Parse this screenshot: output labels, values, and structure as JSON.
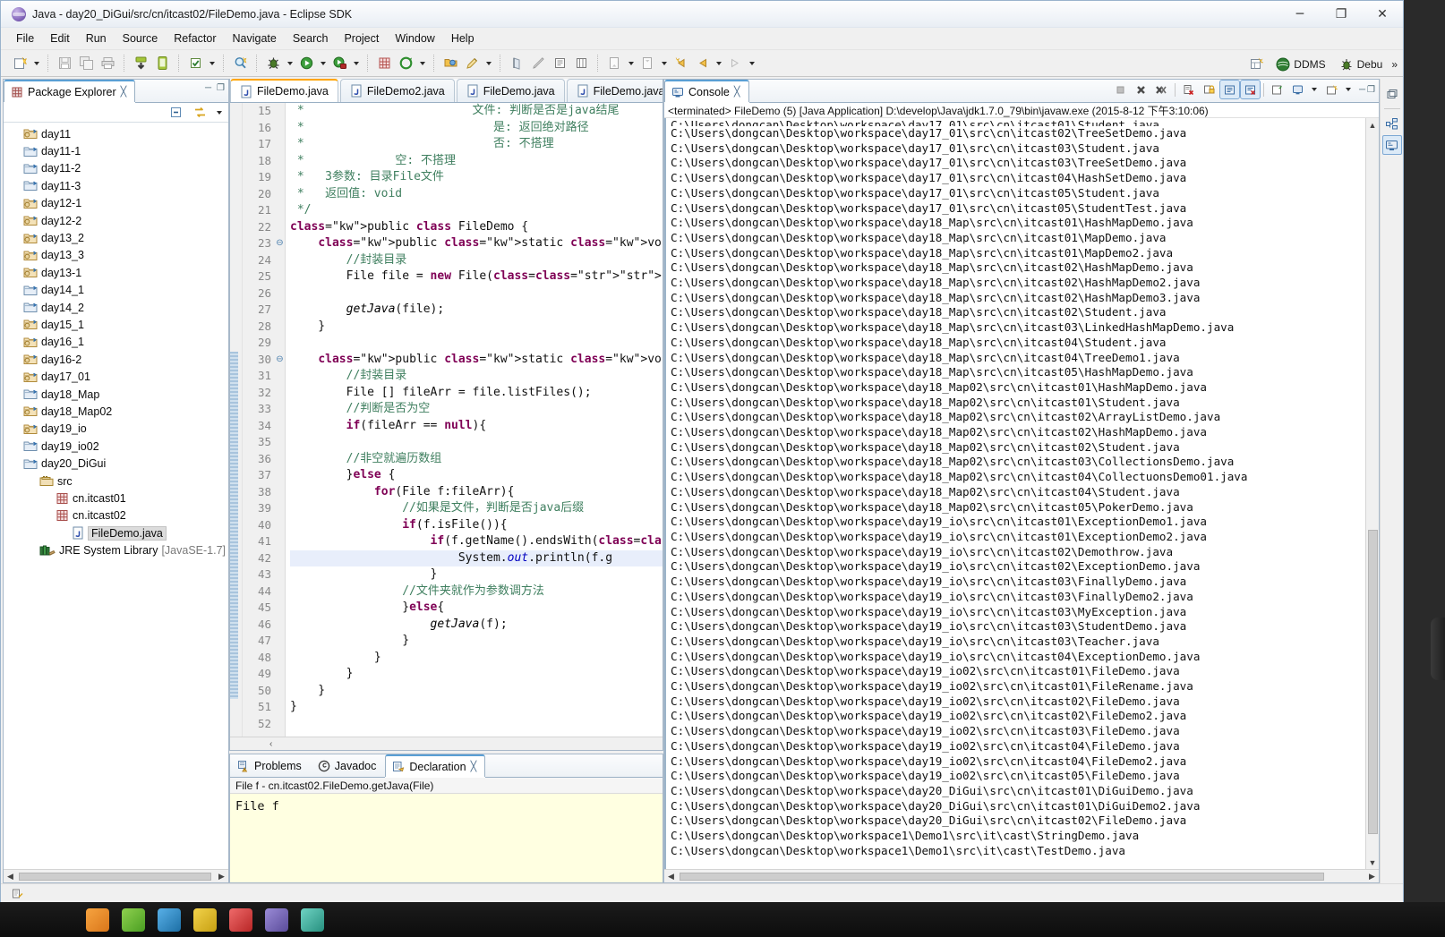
{
  "window": {
    "title": "Java - day20_DiGui/src/cn/itcast02/FileDemo.java - Eclipse SDK",
    "minimize_label": "─",
    "maximize_label": "❐",
    "close_label": "✕"
  },
  "menubar": {
    "items": [
      "File",
      "Edit",
      "Run",
      "Source",
      "Refactor",
      "Navigate",
      "Search",
      "Project",
      "Window",
      "Help"
    ]
  },
  "perspective": {
    "open_perspective_label": "",
    "items": [
      {
        "label": "DDMS",
        "icon": "ddms-icon"
      },
      {
        "label": "Debu",
        "icon": "debug-icon"
      }
    ],
    "overflow": "»"
  },
  "package_explorer": {
    "tab_label": "Package Explorer",
    "close_glyph": "╳",
    "toolbar": {
      "collapse_all": "collapse-all-icon",
      "link_with_editor": "link-with-editor-icon",
      "view_menu": "view-menu-icon"
    },
    "minimize_glyph": "─",
    "maximize_glyph": "❐",
    "items": [
      {
        "label": "day11",
        "icon": "java-project-icon",
        "indent": 0,
        "selected": false
      },
      {
        "label": "day11-1",
        "icon": "folder-project-icon",
        "indent": 0,
        "selected": false
      },
      {
        "label": "day11-2",
        "icon": "folder-project-icon",
        "indent": 0,
        "selected": false
      },
      {
        "label": "day11-3",
        "icon": "folder-project-icon",
        "indent": 0,
        "selected": false
      },
      {
        "label": "day12-1",
        "icon": "java-project-icon",
        "indent": 0,
        "selected": false
      },
      {
        "label": "day12-2",
        "icon": "java-project-icon",
        "indent": 0,
        "selected": false
      },
      {
        "label": "day13_2",
        "icon": "java-project-icon",
        "indent": 0,
        "selected": false
      },
      {
        "label": "day13_3",
        "icon": "java-project-icon",
        "indent": 0,
        "selected": false
      },
      {
        "label": "day13-1",
        "icon": "java-project-icon",
        "indent": 0,
        "selected": false
      },
      {
        "label": "day14_1",
        "icon": "folder-project-icon",
        "indent": 0,
        "selected": false
      },
      {
        "label": "day14_2",
        "icon": "folder-project-icon",
        "indent": 0,
        "selected": false
      },
      {
        "label": "day15_1",
        "icon": "java-project-icon",
        "indent": 0,
        "selected": false
      },
      {
        "label": "day16_1",
        "icon": "java-project-icon",
        "indent": 0,
        "selected": false
      },
      {
        "label": "day16-2",
        "icon": "java-project-icon",
        "indent": 0,
        "selected": false
      },
      {
        "label": "day17_01",
        "icon": "java-project-icon",
        "indent": 0,
        "selected": false
      },
      {
        "label": "day18_Map",
        "icon": "folder-project-icon",
        "indent": 0,
        "selected": false
      },
      {
        "label": "day18_Map02",
        "icon": "java-project-icon",
        "indent": 0,
        "selected": false
      },
      {
        "label": "day19_io",
        "icon": "java-project-icon",
        "indent": 0,
        "selected": false
      },
      {
        "label": "day19_io02",
        "icon": "folder-project-icon",
        "indent": 0,
        "selected": false
      },
      {
        "label": "day20_DiGui",
        "icon": "folder-project-icon",
        "indent": 0,
        "selected": false
      },
      {
        "label": "src",
        "icon": "source-folder-icon",
        "indent": 1,
        "selected": false
      },
      {
        "label": "cn.itcast01",
        "icon": "package-icon",
        "indent": 2,
        "selected": false
      },
      {
        "label": "cn.itcast02",
        "icon": "package-icon",
        "indent": 2,
        "selected": false
      },
      {
        "label": "FileDemo.java",
        "icon": "java-file-icon",
        "indent": 3,
        "selected": true
      },
      {
        "label": "JRE System Library",
        "sub": "[JavaSE-1.7]",
        "icon": "jre-library-icon",
        "indent": 1,
        "selected": false
      }
    ]
  },
  "editor": {
    "tabs": [
      {
        "label": "FileDemo.java",
        "icon": "java-file-icon",
        "active": true
      },
      {
        "label": "FileDemo2.java",
        "icon": "java-file-icon",
        "active": false
      },
      {
        "label": "FileDemo.java",
        "icon": "java-file-icon",
        "active": false
      },
      {
        "label": "FileDemo.java",
        "icon": "java-file-icon",
        "active": false
      }
    ],
    "first_line_number": 15,
    "lines": [
      {
        "n": 15,
        "fold": "",
        "highlight": false,
        "text": " *                        文件: 判断是否是java结尾",
        "cls": "cmt"
      },
      {
        "n": 16,
        "fold": "",
        "highlight": false,
        "text": " *                           是: 返回绝对路径",
        "cls": "cmt"
      },
      {
        "n": 17,
        "fold": "",
        "highlight": false,
        "text": " *                           否: 不搭理",
        "cls": "cmt"
      },
      {
        "n": 18,
        "fold": "",
        "highlight": false,
        "text": " *             空: 不搭理",
        "cls": "cmt"
      },
      {
        "n": 19,
        "fold": "",
        "highlight": false,
        "text": " *   3参数: 目录File文件",
        "cls": "cmt"
      },
      {
        "n": 20,
        "fold": "",
        "highlight": false,
        "text": " *   返回值: void",
        "cls": "cmt"
      },
      {
        "n": 21,
        "fold": "",
        "highlight": false,
        "text": " */",
        "cls": "cmt"
      },
      {
        "n": 22,
        "fold": "",
        "highlight": false,
        "text": "public class FileDemo {",
        "cls": "code22"
      },
      {
        "n": 23,
        "fold": "⊖",
        "highlight": false,
        "text": "    public static void main(String[] args) {",
        "cls": "code23"
      },
      {
        "n": 24,
        "fold": "",
        "highlight": false,
        "text": "        //封装目录",
        "cls": "cmt"
      },
      {
        "n": 25,
        "fold": "",
        "highlight": false,
        "text": "        File file = new File(\"C:\\\\Users\\\\dongc",
        "cls": "code25"
      },
      {
        "n": 26,
        "fold": "",
        "highlight": false,
        "text": "",
        "cls": ""
      },
      {
        "n": 27,
        "fold": "",
        "highlight": false,
        "text": "        getJava(file);",
        "cls": "code27"
      },
      {
        "n": 28,
        "fold": "",
        "highlight": false,
        "text": "    }",
        "cls": ""
      },
      {
        "n": 29,
        "fold": "",
        "highlight": false,
        "text": "",
        "cls": ""
      },
      {
        "n": 30,
        "fold": "⊖",
        "highlight": false,
        "text": "    public static void getJava(File file){",
        "cls": "code30"
      },
      {
        "n": 31,
        "fold": "",
        "highlight": false,
        "text": "        //封装目录",
        "cls": "cmt"
      },
      {
        "n": 32,
        "fold": "",
        "highlight": false,
        "text": "        File [] fileArr = file.listFiles();",
        "cls": ""
      },
      {
        "n": 33,
        "fold": "",
        "highlight": false,
        "text": "        //判断是否为空",
        "cls": "cmt"
      },
      {
        "n": 34,
        "fold": "",
        "highlight": false,
        "text": "        if(fileArr == null){",
        "cls": "code34"
      },
      {
        "n": 35,
        "fold": "",
        "highlight": false,
        "text": "",
        "cls": ""
      },
      {
        "n": 36,
        "fold": "",
        "highlight": false,
        "text": "        //非空就遍历数组",
        "cls": "cmt"
      },
      {
        "n": 37,
        "fold": "",
        "highlight": false,
        "text": "        }else {",
        "cls": "code37"
      },
      {
        "n": 38,
        "fold": "",
        "highlight": false,
        "text": "            for(File f:fileArr){",
        "cls": "code38"
      },
      {
        "n": 39,
        "fold": "",
        "highlight": false,
        "text": "                //如果是文件，判断是否java后缀",
        "cls": "cmt"
      },
      {
        "n": 40,
        "fold": "",
        "highlight": false,
        "text": "                if(f.isFile()){",
        "cls": "code40"
      },
      {
        "n": 41,
        "fold": "",
        "highlight": false,
        "text": "                    if(f.getName().endsWith(\".",
        "cls": "code41"
      },
      {
        "n": 42,
        "fold": "",
        "highlight": true,
        "text": "                        System.out.println(f.g",
        "cls": "code42"
      },
      {
        "n": 43,
        "fold": "",
        "highlight": false,
        "text": "                    }",
        "cls": ""
      },
      {
        "n": 44,
        "fold": "",
        "highlight": false,
        "text": "                //文件夹就作为参数调方法",
        "cls": "cmt"
      },
      {
        "n": 45,
        "fold": "",
        "highlight": false,
        "text": "                }else{",
        "cls": "code45"
      },
      {
        "n": 46,
        "fold": "",
        "highlight": false,
        "text": "                    getJava(f);",
        "cls": "code46"
      },
      {
        "n": 47,
        "fold": "",
        "highlight": false,
        "text": "                }",
        "cls": ""
      },
      {
        "n": 48,
        "fold": "",
        "highlight": false,
        "text": "            }",
        "cls": ""
      },
      {
        "n": 49,
        "fold": "",
        "highlight": false,
        "text": "        }",
        "cls": ""
      },
      {
        "n": 50,
        "fold": "",
        "highlight": false,
        "text": "    }",
        "cls": ""
      },
      {
        "n": 51,
        "fold": "",
        "highlight": false,
        "text": "}",
        "cls": ""
      },
      {
        "n": 52,
        "fold": "",
        "highlight": false,
        "text": "",
        "cls": ""
      }
    ]
  },
  "bottom_panel": {
    "tabs": [
      {
        "label": "Problems",
        "icon": "problems-icon",
        "active": false
      },
      {
        "label": "Javadoc",
        "icon": "javadoc-icon",
        "active": false
      },
      {
        "label": "Declaration",
        "icon": "declaration-icon",
        "active": true
      }
    ],
    "close_glyph": "╳",
    "header": "File f - cn.itcast02.FileDemo.getJava(File)",
    "content": "File f"
  },
  "console": {
    "tab_label": "Console",
    "close_glyph": "╳",
    "toolbar_icons": [
      "terminate-icon",
      "remove-launch-icon",
      "remove-all-terminated-icon",
      "clear-console-icon",
      "scroll-lock-icon",
      "word-wrap-icon",
      "show-console-on-output-icon",
      "pin-console-icon",
      "display-selected-console-icon",
      "display-dropdown-icon",
      "open-console-icon",
      "open-console-dropdown-icon"
    ],
    "minimize_glyph": "─",
    "maximize_glyph": "❐",
    "status_line": "<terminated> FileDemo (5) [Java Application] D:\\develop\\Java\\jdk1.7.0_79\\bin\\javaw.exe (2015-8-12 下午3:10:06)",
    "clipped_first_line": "C:\\Users\\dongcan\\Desktop\\workspace\\day17_01\\src\\cn\\itcast01\\Student.java",
    "lines": [
      "C:\\Users\\dongcan\\Desktop\\workspace\\day17_01\\src\\cn\\itcast02\\TreeSetDemo.java",
      "C:\\Users\\dongcan\\Desktop\\workspace\\day17_01\\src\\cn\\itcast03\\Student.java",
      "C:\\Users\\dongcan\\Desktop\\workspace\\day17_01\\src\\cn\\itcast03\\TreeSetDemo.java",
      "C:\\Users\\dongcan\\Desktop\\workspace\\day17_01\\src\\cn\\itcast04\\HashSetDemo.java",
      "C:\\Users\\dongcan\\Desktop\\workspace\\day17_01\\src\\cn\\itcast05\\Student.java",
      "C:\\Users\\dongcan\\Desktop\\workspace\\day17_01\\src\\cn\\itcast05\\StudentTest.java",
      "C:\\Users\\dongcan\\Desktop\\workspace\\day18_Map\\src\\cn\\itcast01\\HashMapDemo.java",
      "C:\\Users\\dongcan\\Desktop\\workspace\\day18_Map\\src\\cn\\itcast01\\MapDemo.java",
      "C:\\Users\\dongcan\\Desktop\\workspace\\day18_Map\\src\\cn\\itcast01\\MapDemo2.java",
      "C:\\Users\\dongcan\\Desktop\\workspace\\day18_Map\\src\\cn\\itcast02\\HashMapDemo.java",
      "C:\\Users\\dongcan\\Desktop\\workspace\\day18_Map\\src\\cn\\itcast02\\HashMapDemo2.java",
      "C:\\Users\\dongcan\\Desktop\\workspace\\day18_Map\\src\\cn\\itcast02\\HashMapDemo3.java",
      "C:\\Users\\dongcan\\Desktop\\workspace\\day18_Map\\src\\cn\\itcast02\\Student.java",
      "C:\\Users\\dongcan\\Desktop\\workspace\\day18_Map\\src\\cn\\itcast03\\LinkedHashMapDemo.java",
      "C:\\Users\\dongcan\\Desktop\\workspace\\day18_Map\\src\\cn\\itcast04\\Student.java",
      "C:\\Users\\dongcan\\Desktop\\workspace\\day18_Map\\src\\cn\\itcast04\\TreeDemo1.java",
      "C:\\Users\\dongcan\\Desktop\\workspace\\day18_Map\\src\\cn\\itcast05\\HashMapDemo.java",
      "C:\\Users\\dongcan\\Desktop\\workspace\\day18_Map02\\src\\cn\\itcast01\\HashMapDemo.java",
      "C:\\Users\\dongcan\\Desktop\\workspace\\day18_Map02\\src\\cn\\itcast01\\Student.java",
      "C:\\Users\\dongcan\\Desktop\\workspace\\day18_Map02\\src\\cn\\itcast02\\ArrayListDemo.java",
      "C:\\Users\\dongcan\\Desktop\\workspace\\day18_Map02\\src\\cn\\itcast02\\HashMapDemo.java",
      "C:\\Users\\dongcan\\Desktop\\workspace\\day18_Map02\\src\\cn\\itcast02\\Student.java",
      "C:\\Users\\dongcan\\Desktop\\workspace\\day18_Map02\\src\\cn\\itcast03\\CollectionsDemo.java",
      "C:\\Users\\dongcan\\Desktop\\workspace\\day18_Map02\\src\\cn\\itcast04\\CollectuonsDemo01.java",
      "C:\\Users\\dongcan\\Desktop\\workspace\\day18_Map02\\src\\cn\\itcast04\\Student.java",
      "C:\\Users\\dongcan\\Desktop\\workspace\\day18_Map02\\src\\cn\\itcast05\\PokerDemo.java",
      "C:\\Users\\dongcan\\Desktop\\workspace\\day19_io\\src\\cn\\itcast01\\ExceptionDemo1.java",
      "C:\\Users\\dongcan\\Desktop\\workspace\\day19_io\\src\\cn\\itcast01\\ExceptionDemo2.java",
      "C:\\Users\\dongcan\\Desktop\\workspace\\day19_io\\src\\cn\\itcast02\\Demothrow.java",
      "C:\\Users\\dongcan\\Desktop\\workspace\\day19_io\\src\\cn\\itcast02\\ExceptionDemo.java",
      "C:\\Users\\dongcan\\Desktop\\workspace\\day19_io\\src\\cn\\itcast03\\FinallyDemo.java",
      "C:\\Users\\dongcan\\Desktop\\workspace\\day19_io\\src\\cn\\itcast03\\FinallyDemo2.java",
      "C:\\Users\\dongcan\\Desktop\\workspace\\day19_io\\src\\cn\\itcast03\\MyException.java",
      "C:\\Users\\dongcan\\Desktop\\workspace\\day19_io\\src\\cn\\itcast03\\StudentDemo.java",
      "C:\\Users\\dongcan\\Desktop\\workspace\\day19_io\\src\\cn\\itcast03\\Teacher.java",
      "C:\\Users\\dongcan\\Desktop\\workspace\\day19_io\\src\\cn\\itcast04\\ExceptionDemo.java",
      "C:\\Users\\dongcan\\Desktop\\workspace\\day19_io02\\src\\cn\\itcast01\\FileDemo.java",
      "C:\\Users\\dongcan\\Desktop\\workspace\\day19_io02\\src\\cn\\itcast01\\FileRename.java",
      "C:\\Users\\dongcan\\Desktop\\workspace\\day19_io02\\src\\cn\\itcast02\\FileDemo.java",
      "C:\\Users\\dongcan\\Desktop\\workspace\\day19_io02\\src\\cn\\itcast02\\FileDemo2.java",
      "C:\\Users\\dongcan\\Desktop\\workspace\\day19_io02\\src\\cn\\itcast03\\FileDemo.java",
      "C:\\Users\\dongcan\\Desktop\\workspace\\day19_io02\\src\\cn\\itcast04\\FileDemo.java",
      "C:\\Users\\dongcan\\Desktop\\workspace\\day19_io02\\src\\cn\\itcast04\\FileDemo2.java",
      "C:\\Users\\dongcan\\Desktop\\workspace\\day19_io02\\src\\cn\\itcast05\\FileDemo.java",
      "C:\\Users\\dongcan\\Desktop\\workspace\\day20_DiGui\\src\\cn\\itcast01\\DiGuiDemo.java",
      "C:\\Users\\dongcan\\Desktop\\workspace\\day20_DiGui\\src\\cn\\itcast01\\DiGuiDemo2.java",
      "C:\\Users\\dongcan\\Desktop\\workspace\\day20_DiGui\\src\\cn\\itcast02\\FileDemo.java",
      "C:\\Users\\dongcan\\Desktop\\workspace1\\Demo1\\src\\it\\cast\\StringDemo.java",
      "C:\\Users\\dongcan\\Desktop\\workspace1\\Demo1\\src\\it\\cast\\TestDemo.java"
    ]
  },
  "right_rail": {
    "items": [
      {
        "icon": "restore-icon",
        "active": false
      },
      {
        "icon": "outline-icon",
        "active": false
      },
      {
        "icon": "console-icon",
        "active": true
      }
    ]
  },
  "statusbar": {
    "items": [
      {
        "icon": "writable-indicator-icon",
        "label": ""
      }
    ]
  },
  "colors": {
    "accent": "#5a9fd4",
    "keyword": "#7f0055",
    "comment": "#3f7f5f",
    "string": "#2a00ff",
    "selection": "#e8eefb",
    "decl_bg": "#ffffe1"
  }
}
